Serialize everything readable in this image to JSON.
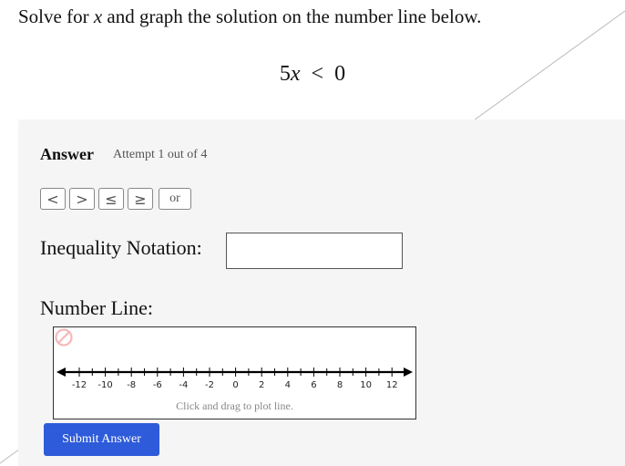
{
  "question": {
    "prefix": "Solve for ",
    "variable": "x",
    "suffix": " and graph the solution on the number line below."
  },
  "equation": {
    "coef": "5",
    "variable": "x",
    "relation": "<",
    "rhs": "0"
  },
  "answer": {
    "title": "Answer",
    "attempt": "Attempt 1 out of 4"
  },
  "symbol_buttons": [
    "<",
    ">",
    "≤",
    "≥",
    "or"
  ],
  "inequality": {
    "label": "Inequality Notation:",
    "value": ""
  },
  "number_line": {
    "label": "Number Line:",
    "ticks": [
      -12,
      -11,
      -10,
      -9,
      -8,
      -7,
      -6,
      -5,
      -4,
      -3,
      -2,
      -1,
      0,
      1,
      2,
      3,
      4,
      5,
      6,
      7,
      8,
      9,
      10,
      11,
      12
    ],
    "labels": [
      "-12",
      "-10",
      "-8",
      "-6",
      "-4",
      "-2",
      "0",
      "2",
      "4",
      "6",
      "8",
      "10",
      "12"
    ],
    "hint": "Click and drag to plot line.",
    "clear_icon": "no-entry-icon",
    "clear_color": "#f5b8b8"
  },
  "submit": {
    "label": "Submit Answer",
    "color": "#2e5bd9"
  }
}
